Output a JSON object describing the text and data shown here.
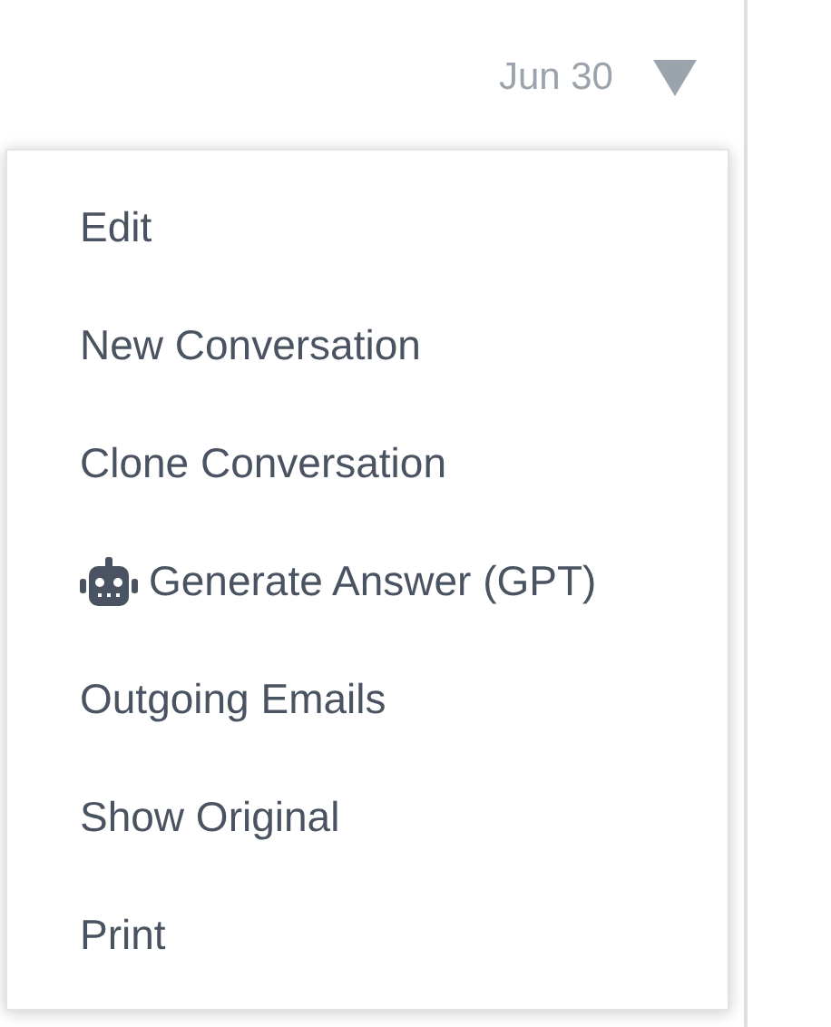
{
  "conversation": {
    "date": "Jun 30"
  },
  "menu": {
    "items": [
      {
        "label": "Edit",
        "kind": "plain"
      },
      {
        "label": "New Conversation",
        "kind": "plain"
      },
      {
        "label": "Clone Conversation",
        "kind": "plain"
      },
      {
        "label": "Generate Answer (GPT)",
        "kind": "robot"
      },
      {
        "label": "Outgoing Emails",
        "kind": "plain"
      },
      {
        "label": "Show Original",
        "kind": "plain"
      },
      {
        "label": "Print",
        "kind": "plain"
      }
    ]
  }
}
